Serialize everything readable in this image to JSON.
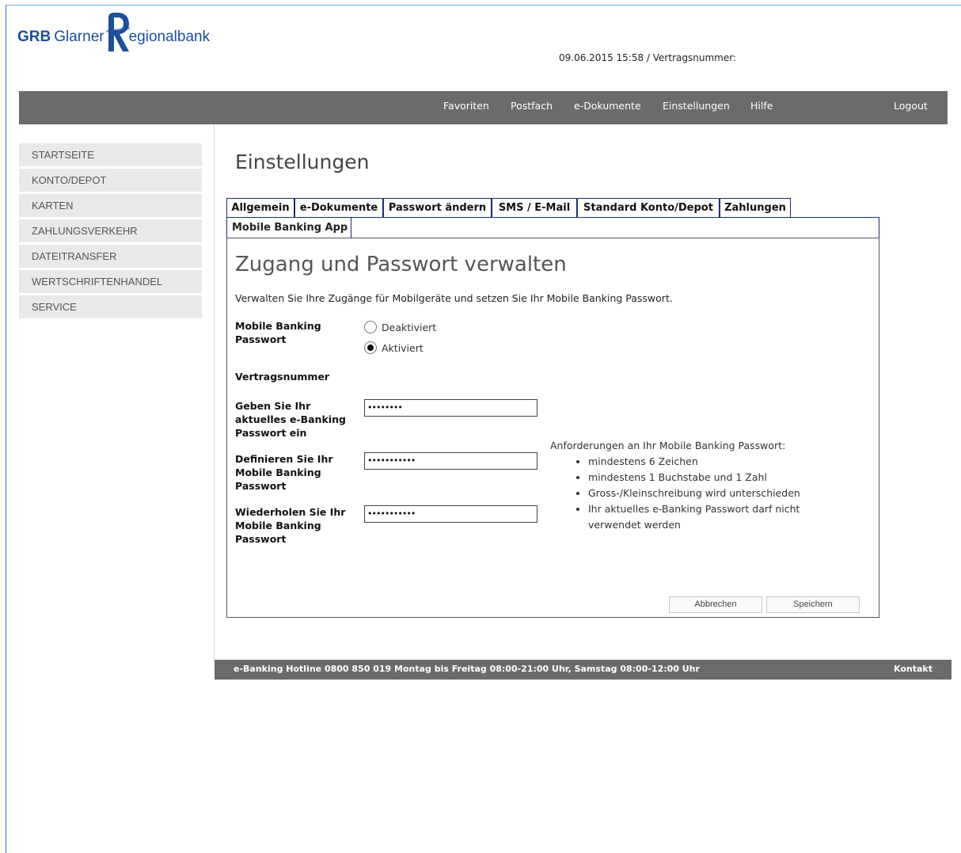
{
  "brand": {
    "abbr": "GRB",
    "name_part1": "Glarner",
    "name_letter": "R",
    "name_part2": "egionalbank",
    "color": "#1d4f9a"
  },
  "header": {
    "datetime": "09.06.2015 15:58 / Vertragsnummer:"
  },
  "topnav": {
    "items": [
      "Favoriten",
      "Postfach",
      "e-Dokumente",
      "Einstellungen",
      "Hilfe"
    ],
    "logout": "Logout"
  },
  "sidebar": {
    "items": [
      "STARTSEITE",
      "KONTO/DEPOT",
      "KARTEN",
      "ZAHLUNGSVERKEHR",
      "DATEITRANSFER",
      "WERTSCHRIFTENHANDEL",
      "SERVICE"
    ]
  },
  "page": {
    "title": "Einstellungen"
  },
  "tabs": {
    "items": [
      "Allgemein",
      "e-Dokumente",
      "Passwort ändern",
      "SMS / E-Mail",
      "Standard Konto/Depot",
      "Zahlungen"
    ],
    "active": "Mobile Banking App"
  },
  "panel": {
    "title": "Zugang und Passwort verwalten",
    "intro": "Verwalten Sie Ihre Zugänge für Mobilgeräte und setzen Sie Ihr Mobile Banking Passwort.",
    "mobile_pw_label": "Mobile Banking Passwort",
    "options": [
      {
        "label": "Deaktiviert",
        "selected": false
      },
      {
        "label": "Aktiviert",
        "selected": true
      }
    ],
    "contract_label": "Vertragsnummer",
    "current_pw_label": "Geben Sie Ihr aktuelles e-Banking Passwort ein",
    "current_pw_value": "••••••••",
    "new_pw_label": "Definieren Sie Ihr Mobile Banking Passwort",
    "new_pw_value": "•••••••••••",
    "repeat_pw_label": "Wiederholen Sie Ihr Mobile Banking Passwort",
    "repeat_pw_value": "•••••••••••",
    "requirements_title": "Anforderungen an Ihr Mobile Banking Passwort:",
    "requirements": [
      "mindestens 6 Zeichen",
      "mindestens 1 Buchstabe und 1 Zahl",
      "Gross-/Kleinschreibung wird unterschieden",
      "Ihr aktuelles e-Banking Passwort darf nicht verwendet werden"
    ],
    "cancel": "Abbrechen",
    "save": "Speichern"
  },
  "footer": {
    "hotline": "e-Banking Hotline 0800 850 019 Montag bis Freitag 08:00-21:00 Uhr, Samstag 08:00-12:00 Uhr",
    "contact": "Kontakt"
  }
}
